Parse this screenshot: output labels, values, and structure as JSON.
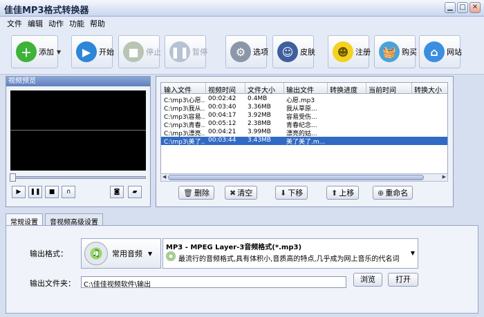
{
  "window": {
    "title": "佳佳MP3格式转换器"
  },
  "menu": [
    "文件",
    "编辑",
    "动作",
    "功能",
    "帮助"
  ],
  "toolbar": {
    "add": "添加",
    "start": "开始",
    "stop": "停止",
    "pause": "暂停",
    "options": "选项",
    "skin": "皮肤",
    "register": "注册",
    "buy": "购买",
    "website": "网站"
  },
  "preview": {
    "title": "视频预览"
  },
  "table": {
    "headers": [
      "输入文件",
      "视频时间",
      "文件大小",
      "输出文件",
      "转换进度",
      "当前时间",
      "转换大小"
    ],
    "rows": [
      [
        "C:\\mp3\\心愿....",
        "00:02:42",
        "0.4MB",
        "心愿.mp3"
      ],
      [
        "C:\\mp3\\我从...",
        "00:03:40",
        "3.36MB",
        "我从草原..."
      ],
      [
        "C:\\mp3\\容易...",
        "00:04:17",
        "3.92MB",
        "容易受伤..."
      ],
      [
        "C:\\mp3\\青春...",
        "00:05:12",
        "2.38MB",
        "青春纪念..."
      ],
      [
        "C:\\mp3\\漂亮...",
        "00:04:21",
        "3.99MB",
        "漂亮的姑..."
      ],
      [
        "C:\\mp3\\美了...",
        "00:03:44",
        "3.43MB",
        "美了美了.m..."
      ]
    ],
    "selected_row": 5
  },
  "actions": {
    "delete": "删除",
    "clear": "清空",
    "down": "下移",
    "up": "上移",
    "rename": "重命名"
  },
  "tabs": [
    "常规设置",
    "音视频高级设置"
  ],
  "settings": {
    "format_label": "输出格式：",
    "format_category": "常用音频",
    "format_name": "MP3 - MPEG Layer-3音频格式(*.mp3)",
    "format_desc": "最流行的音频格式,具有体积小,音质高的特点,几乎成为网上音乐的代名词",
    "folder_label": "输出文件夹：",
    "folder_value": "C:\\佳佳视频软件\\输出",
    "browse": "浏览",
    "open": "打开"
  }
}
